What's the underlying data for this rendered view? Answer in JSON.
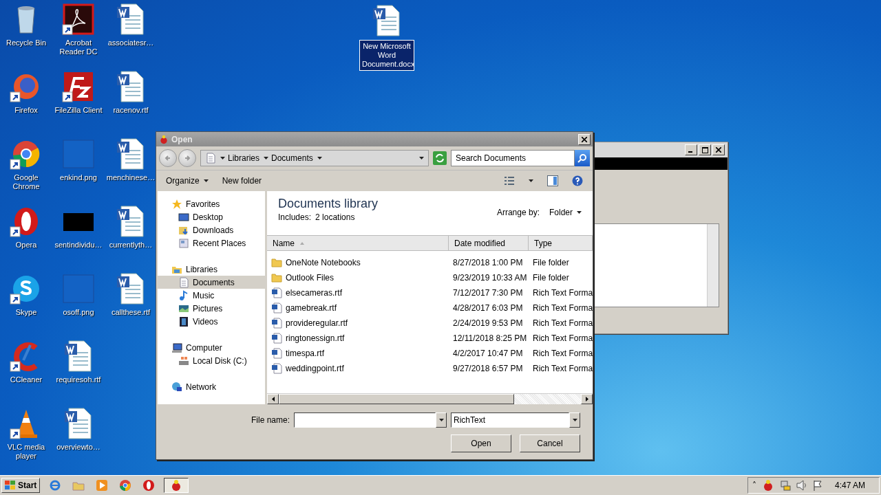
{
  "desktop": {
    "icons": [
      {
        "label": "Recycle Bin",
        "kind": "recycle",
        "shortcut": false
      },
      {
        "label": "Firefox",
        "kind": "firefox",
        "shortcut": true
      },
      {
        "label": "Google Chrome",
        "kind": "chrome",
        "shortcut": true
      },
      {
        "label": "Opera",
        "kind": "opera",
        "shortcut": true
      },
      {
        "label": "Skype",
        "kind": "skype",
        "shortcut": true
      },
      {
        "label": "CCleaner",
        "kind": "ccleaner",
        "shortcut": true
      },
      {
        "label": "VLC media player",
        "kind": "vlc",
        "shortcut": true
      },
      {
        "label": "Acrobat Reader DC",
        "kind": "acrobat",
        "shortcut": true
      },
      {
        "label": "FileZilla Client",
        "kind": "filezilla",
        "shortcut": true
      },
      {
        "label": "enkind.png",
        "kind": "blank",
        "shortcut": false
      },
      {
        "label": "sentindividu…",
        "kind": "dark",
        "shortcut": false
      },
      {
        "label": "osoff.png",
        "kind": "blank",
        "shortcut": false
      },
      {
        "label": "requiresoh.rtf",
        "kind": "word",
        "shortcut": false
      },
      {
        "label": "overviewto…",
        "kind": "word",
        "shortcut": false
      },
      {
        "label": "associatesr…",
        "kind": "word",
        "shortcut": false
      },
      {
        "label": "racenov.rtf",
        "kind": "word",
        "shortcut": false
      },
      {
        "label": "menchinese…",
        "kind": "word",
        "shortcut": false
      },
      {
        "label": "currentlyth…",
        "kind": "word",
        "shortcut": false
      },
      {
        "label": "callthese.rtf",
        "kind": "word",
        "shortcut": false
      }
    ],
    "selected_icon": {
      "label": "New Microsoft Word Document.docx",
      "kind": "word",
      "selected": true
    }
  },
  "dialog": {
    "title": "Open",
    "breadcrumb": [
      "Libraries",
      "Documents"
    ],
    "search": {
      "placeholder": "Search Documents"
    },
    "toolbar": [
      {
        "label": "Organize",
        "dropdown": true
      },
      {
        "label": "New folder",
        "dropdown": false
      }
    ],
    "nav": [
      {
        "label": "Favorites",
        "kind": "star",
        "selected": false,
        "children": [
          {
            "label": "Desktop",
            "kind": "desktop",
            "selected": false
          },
          {
            "label": "Downloads",
            "kind": "downloads",
            "selected": false
          },
          {
            "label": "Recent Places",
            "kind": "recent",
            "selected": false
          }
        ]
      },
      {
        "label": "Libraries",
        "kind": "library",
        "selected": false,
        "children": [
          {
            "label": "Documents",
            "kind": "documents",
            "selected": true
          },
          {
            "label": "Music",
            "kind": "music",
            "selected": false
          },
          {
            "label": "Pictures",
            "kind": "pictures",
            "selected": false
          },
          {
            "label": "Videos",
            "kind": "videos",
            "selected": false
          }
        ]
      },
      {
        "label": "Computer",
        "kind": "computer",
        "selected": false,
        "children": [
          {
            "label": "Local Disk (C:)",
            "kind": "disk",
            "selected": false
          }
        ]
      },
      {
        "label": "Network",
        "kind": "network",
        "selected": false
      }
    ],
    "library": {
      "title": "Documents library",
      "includes_label": "Includes:",
      "includes_value": "2 locations",
      "arrange_label": "Arrange by:",
      "arrange_value": "Folder"
    },
    "columns": [
      "Name",
      "Date modified",
      "Type"
    ],
    "rows": [
      {
        "name": "OneNote Notebooks",
        "kind": "folder",
        "date": "8/27/2018 1:00 PM",
        "type": "File folder"
      },
      {
        "name": "Outlook Files",
        "kind": "folder",
        "date": "9/23/2019 10:33 AM",
        "type": "File folder"
      },
      {
        "name": "elsecameras.rtf",
        "kind": "rtf",
        "date": "7/12/2017 7:30 PM",
        "type": "Rich Text Forma"
      },
      {
        "name": "gamebreak.rtf",
        "kind": "rtf",
        "date": "4/28/2017 6:03 PM",
        "type": "Rich Text Forma"
      },
      {
        "name": "provideregular.rtf",
        "kind": "rtf",
        "date": "2/24/2019 9:53 PM",
        "type": "Rich Text Forma"
      },
      {
        "name": "ringtonessign.rtf",
        "kind": "rtf",
        "date": "12/11/2018 8:25 PM",
        "type": "Rich Text Forma"
      },
      {
        "name": "timespa.rtf",
        "kind": "rtf",
        "date": "4/2/2017 10:47 PM",
        "type": "Rich Text Forma"
      },
      {
        "name": "weddingpoint.rtf",
        "kind": "rtf",
        "date": "9/27/2018 6:57 PM",
        "type": "Rich Text Forma"
      }
    ],
    "file_name_label": "File name:",
    "filter_value": "RichText",
    "buttons": [
      "Open",
      "Cancel"
    ]
  },
  "taskbar": {
    "start": "Start",
    "apps": [
      {
        "kind": "ie"
      },
      {
        "kind": "explorer"
      },
      {
        "kind": "media"
      },
      {
        "kind": "chrome"
      },
      {
        "kind": "opera"
      },
      {
        "kind": "app",
        "selected": true
      }
    ],
    "tray_expand": "˄",
    "time": "4:47 AM"
  }
}
